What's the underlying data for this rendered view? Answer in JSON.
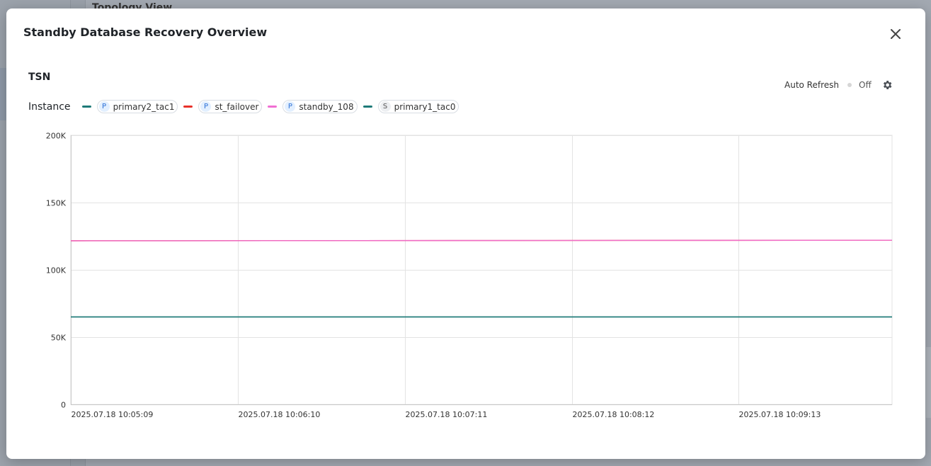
{
  "background": {
    "section_title": "Topology View"
  },
  "modal": {
    "title": "Standby Database Recovery Overview",
    "close_icon": "close-icon"
  },
  "section": {
    "title": "TSN"
  },
  "auto_refresh": {
    "label": "Auto Refresh",
    "state": "Off",
    "settings_icon": "gear-icon"
  },
  "legend": {
    "title": "Instance",
    "items": [
      {
        "badge": "P",
        "name": "primary2_tac1",
        "color": "#1e7a78"
      },
      {
        "badge": "P",
        "name": "st_failover",
        "color": "#e8312a"
      },
      {
        "badge": "P",
        "name": "standby_108",
        "color": "#f06fd2"
      },
      {
        "badge": "S",
        "name": "primary1_tac0",
        "color": "#1e7a78"
      }
    ]
  },
  "chart_data": {
    "type": "line",
    "title": "",
    "xlabel": "",
    "ylabel": "",
    "ylim": [
      0,
      200000
    ],
    "y_ticks": [
      {
        "value": 0,
        "label": "0"
      },
      {
        "value": 50000,
        "label": "50K"
      },
      {
        "value": 100000,
        "label": "100K"
      },
      {
        "value": 150000,
        "label": "150K"
      },
      {
        "value": 200000,
        "label": "200K"
      }
    ],
    "x_ticks": [
      "2025.07.18 10:05:09",
      "2025.07.18 10:06:10",
      "2025.07.18 10:07:11",
      "2025.07.18 10:08:12",
      "2025.07.18 10:09:13"
    ],
    "x_range_seconds": [
      0,
      300
    ],
    "x_tick_seconds": [
      0,
      61,
      122,
      183,
      244
    ],
    "grid": true,
    "legend_placement": "top-left",
    "series": [
      {
        "name": "primary2_tac1",
        "color": "#1e7a78",
        "x": [
          0,
          300
        ],
        "values": [
          65000,
          65000
        ]
      },
      {
        "name": "st_failover",
        "color": "#e8312a",
        "x": [
          0,
          300
        ],
        "values": [
          121600,
          122000
        ]
      },
      {
        "name": "standby_108",
        "color": "#f06fd2",
        "x": [
          0,
          300
        ],
        "values": [
          121600,
          122000
        ]
      },
      {
        "name": "primary1_tac0",
        "color": "#1e7a78",
        "x": [
          0,
          300
        ],
        "values": [
          65000,
          65000
        ]
      }
    ]
  }
}
